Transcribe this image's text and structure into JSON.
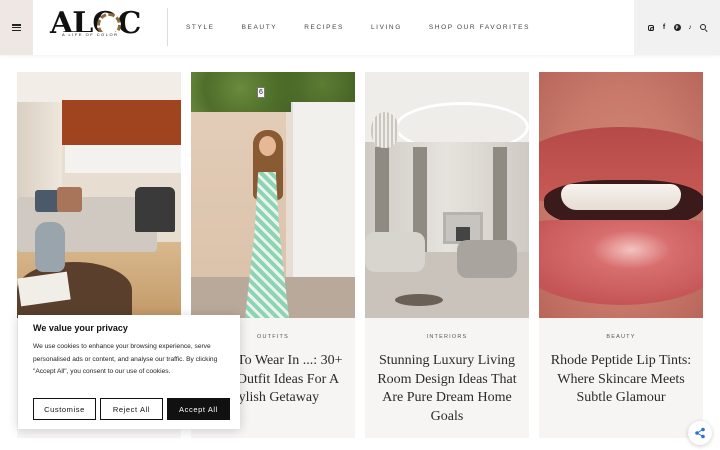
{
  "header": {
    "logo": {
      "text": "ALOC",
      "subtitle": "A LIFE OF COLOR"
    },
    "nav": [
      {
        "label": "STYLE"
      },
      {
        "label": "BEAUTY"
      },
      {
        "label": "RECIPES"
      },
      {
        "label": "LIVING"
      },
      {
        "label": "SHOP OUR FAVORITES"
      }
    ],
    "social_icons": [
      "instagram-icon",
      "facebook-icon",
      "pinterest-icon",
      "tiktok-icon",
      "search-icon"
    ]
  },
  "cards": [
    {
      "category": "",
      "title": ""
    },
    {
      "category": "OUTFITS",
      "title": "What To Wear In ...: 30+ Chic Outfit Ideas For A Stylish Getaway"
    },
    {
      "category": "INTERIORS",
      "title": "Stunning Luxury Living Room Design Ideas That Are Pure Dream Home Goals"
    },
    {
      "category": "BEAUTY",
      "title": "Rhode Peptide Lip Tints: Where Skincare Meets Subtle Glamour"
    }
  ],
  "cookie_banner": {
    "title": "We value your privacy",
    "body": "We use cookies to enhance your browsing experience, serve personalised ads or content, and analyse our traffic. By clicking \"Accept All\", you consent to our use of cookies.",
    "buttons": {
      "customise": "Customise",
      "reject": "Reject All",
      "accept": "Accept All"
    }
  },
  "colors": {
    "menu_bg": "#efe7e4",
    "accept_bg": "#111111",
    "card_bg": "#f7f5f4",
    "share_accent": "#2f6fd6"
  }
}
